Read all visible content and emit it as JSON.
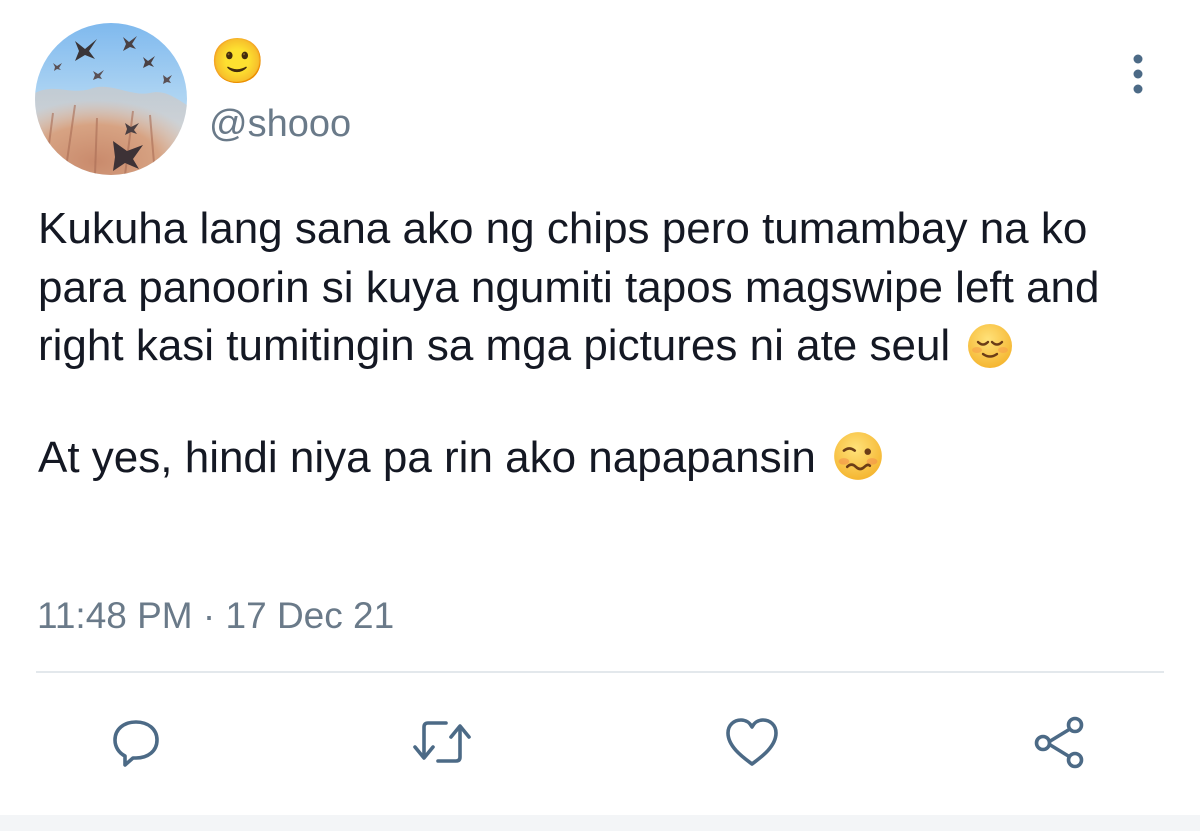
{
  "author": {
    "display_name": "🙂",
    "handle": "@shooo",
    "avatar": "avatar-birds-sky-trees"
  },
  "menu": {
    "icon": "more-vertical-icon"
  },
  "tweet": {
    "paragraph1": "Kukuha lang sana ako ng chips pero tumambay na ko para panoorin si kuya ngumiti tapos magswipe left and right kasi tumitingin sa mga pictures ni ate seul",
    "paragraph1_emoji": "relieved-face-icon",
    "paragraph2": "At yes, hindi niya pa rin ako napapansin",
    "paragraph2_emoji": "woozy-face-icon",
    "timestamp": "11:48 PM · 17 Dec 21"
  },
  "actions": [
    {
      "icon": "reply-icon"
    },
    {
      "icon": "retweet-icon"
    },
    {
      "icon": "like-icon"
    },
    {
      "icon": "share-icon"
    }
  ],
  "colors": {
    "text": "#141823",
    "secondary": "#6a7a89",
    "icon": "#4c6a86",
    "divider": "#e3e8ec"
  }
}
